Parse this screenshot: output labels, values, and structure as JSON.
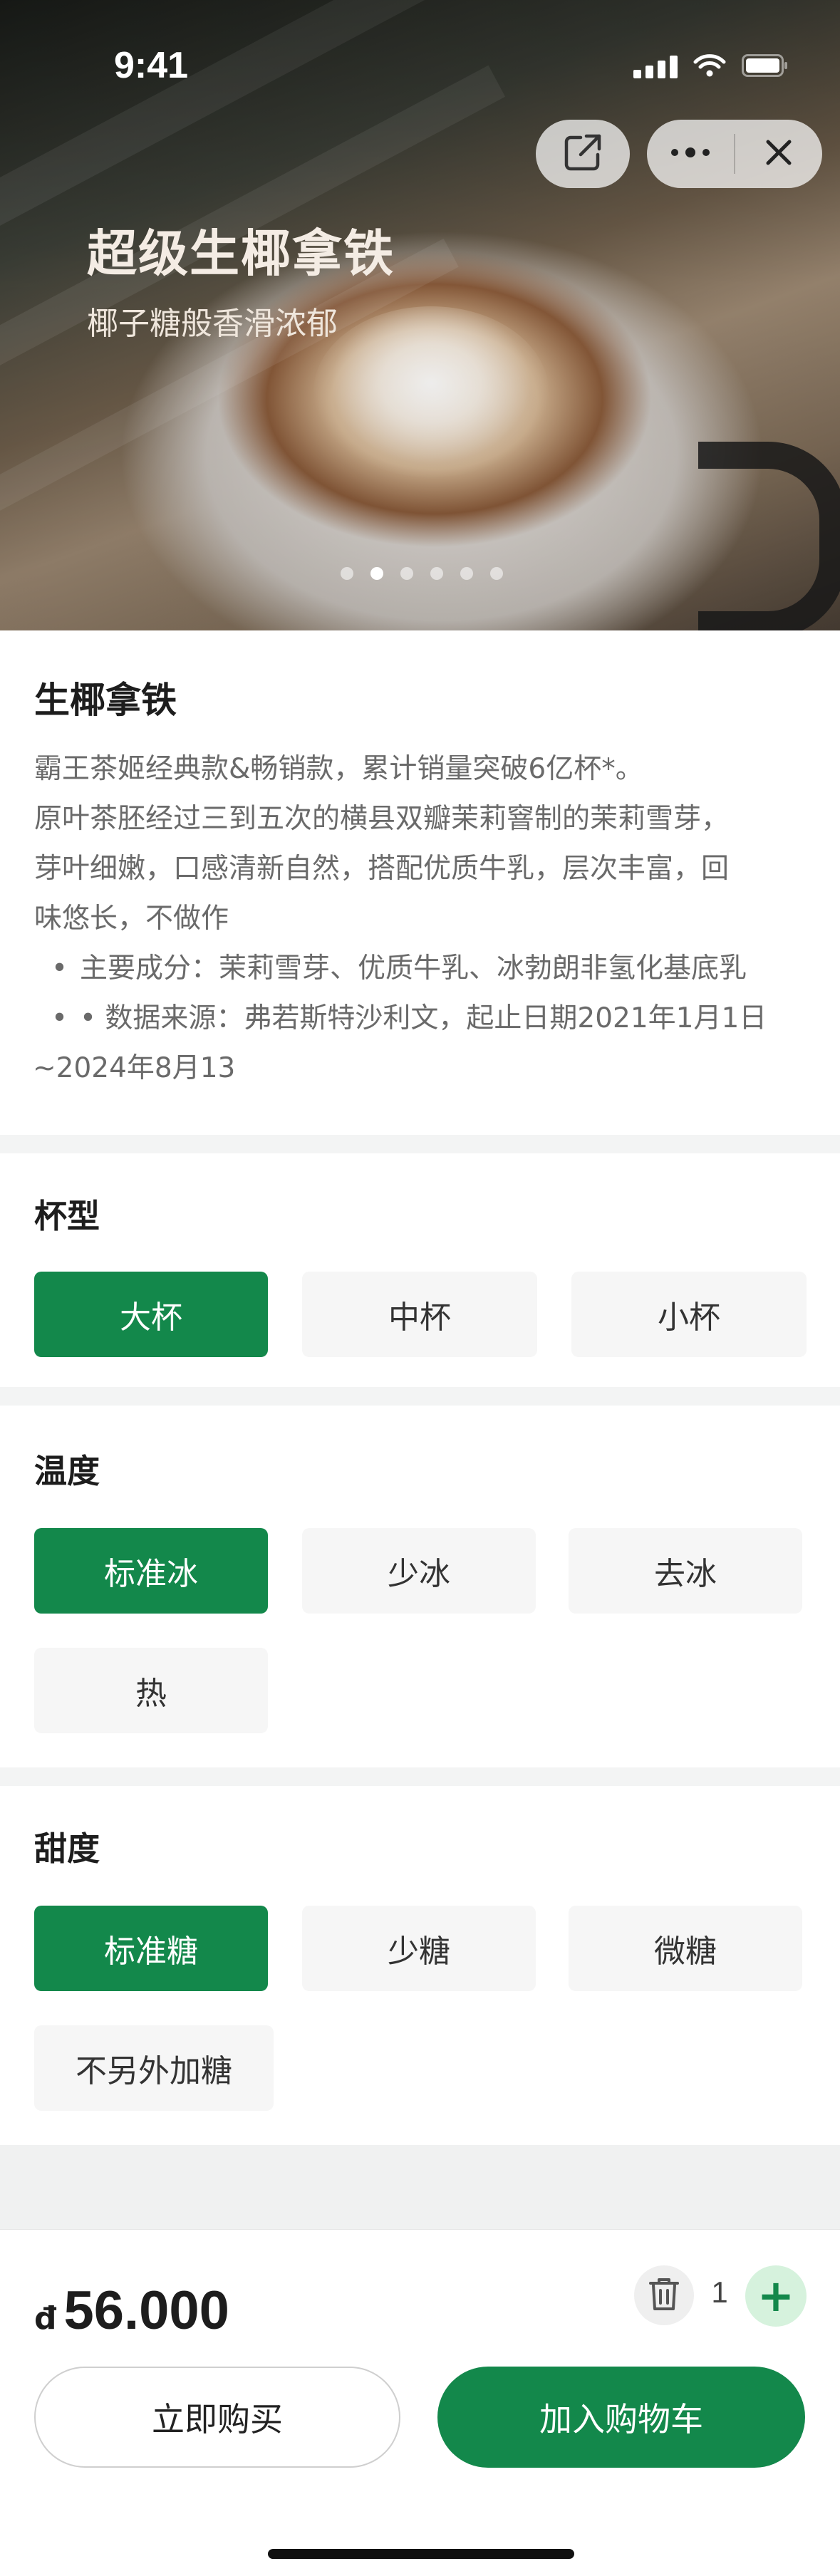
{
  "status_bar": {
    "time": "9:41"
  },
  "hero": {
    "title": "超级生椰拿铁",
    "subtitle": "椰子糖般香滑浓郁",
    "dot_count": 6,
    "active_dot": 1
  },
  "product": {
    "name": "生椰拿铁",
    "description_lines": [
      "霸王茶姬经典款&畅销款，累计销量突破6亿杯*。",
      "原叶茶胚经过三到五次的横县双瓣茉莉窨制的茉莉雪芽，",
      "芽叶细嫩，口感清新自然，搭配优质牛乳，层次丰富，回",
      "味悠长，不做作"
    ],
    "bullet_1": "主要成分：茉莉雪芽、优质牛乳、冰勃朗非氢化基底乳",
    "bullet_2_line1": "• 数据来源：弗若斯特沙利文，起止日期2021年1月1日",
    "bullet_2_line2": "~2024年8月13"
  },
  "size": {
    "title": "杯型",
    "options": [
      "大杯",
      "中杯",
      "小杯"
    ],
    "selected": "大杯"
  },
  "temperature": {
    "title": "温度",
    "options": [
      "标准冰",
      "少冰",
      "去冰",
      "热"
    ],
    "selected": "标准冰"
  },
  "sweetness": {
    "title": "甜度",
    "options": [
      "标准糖",
      "少糖",
      "微糖",
      "不另外加糖"
    ],
    "selected": "标准糖"
  },
  "cart": {
    "currency": "đ",
    "price": "56.000",
    "quantity": "1",
    "plus_label": "+",
    "buy_now_label": "立即购买",
    "add_to_cart_label": "加入购物车"
  },
  "colors": {
    "accent": "#13884b",
    "accent_light": "#d6f2dd",
    "option_bg": "#f6f6f6"
  },
  "icons": [
    "share-icon",
    "more-icon",
    "close-icon",
    "trash-icon",
    "plus-icon"
  ]
}
